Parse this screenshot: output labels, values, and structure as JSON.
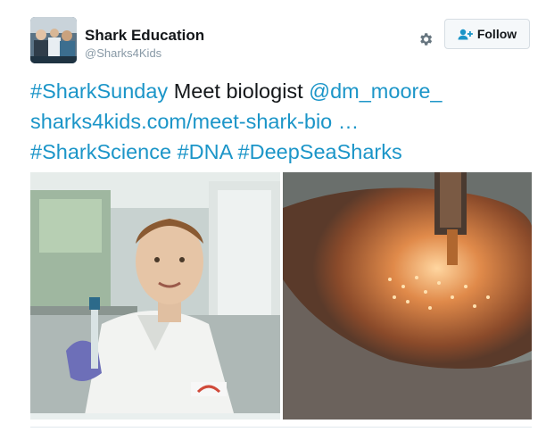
{
  "author": {
    "display_name": "Shark Education",
    "handle": "@Sharks4Kids",
    "avatar_icon": "group-photo-avatar"
  },
  "actions": {
    "settings_icon": "gear-icon",
    "follow_label": "Follow",
    "follow_icon": "add-user-icon"
  },
  "tweet": {
    "hashtag1": "#SharkSunday",
    "text1": " Meet biologist ",
    "mention": "@dm_moore_",
    "link": "sharks4kids.com/meet-shark-bio …",
    "hashtag2": "#SharkScience",
    "hashtag3": "#DNA",
    "hashtag4": "#DeepSeaSharks"
  },
  "media": {
    "left_photo": "biologist-in-lab-photo",
    "right_photo": "shark-skin-closeup-photo"
  },
  "colors": {
    "link": "#1b95c8",
    "text": "#14171a",
    "muted": "#8899a6",
    "button_bg": "#f5f8fa"
  }
}
